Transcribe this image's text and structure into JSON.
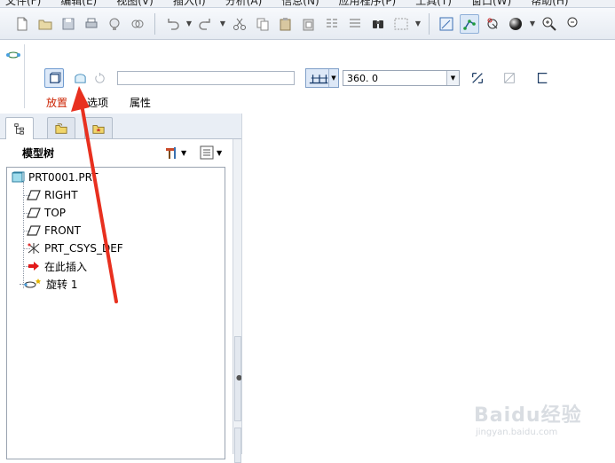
{
  "menubar": {
    "items": [
      "文件(F)",
      "编辑(E)",
      "视图(V)",
      "插入(I)",
      "分析(A)",
      "信息(N)",
      "应用程序(P)",
      "工具(T)",
      "窗口(W)",
      "帮助(H)"
    ]
  },
  "dashboard": {
    "angle_value": "360. 0",
    "tabs": {
      "placement": "放置",
      "options": "选项",
      "properties": "属性"
    },
    "placement_color": "#cc2200"
  },
  "model_tree": {
    "title": "模型树",
    "items": [
      {
        "label": "PRT0001.PRT",
        "icon": "part-icon"
      },
      {
        "label": "RIGHT",
        "icon": "datum-plane-icon"
      },
      {
        "label": "TOP",
        "icon": "datum-plane-icon"
      },
      {
        "label": "FRONT",
        "icon": "datum-plane-icon"
      },
      {
        "label": "PRT_CSYS_DEF",
        "icon": "csys-icon"
      },
      {
        "label": "在此插入",
        "icon": "insert-here-arrow-icon"
      },
      {
        "label": "旋转 1",
        "icon": "revolve-feature-icon"
      }
    ]
  },
  "watermark": {
    "brand": "Baidu经验",
    "url": "jingyan.baidu.com"
  },
  "colors": {
    "annotation_arrow": "#e8301f",
    "accent": "#2b6cc4"
  }
}
